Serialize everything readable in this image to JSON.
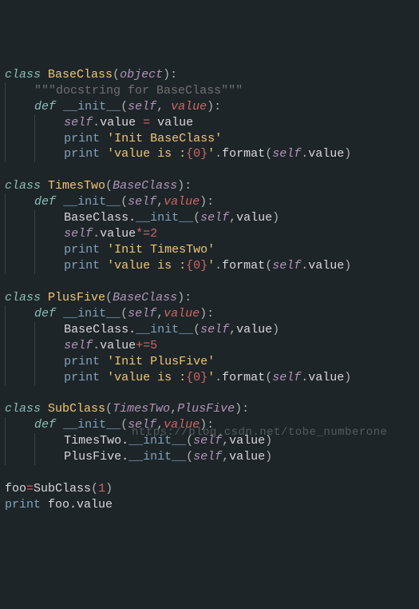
{
  "code": {
    "lines": [
      {
        "indent": 0,
        "tokens": [
          {
            "t": "kw-storage",
            "v": "class"
          },
          {
            "t": "plain",
            "v": " "
          },
          {
            "t": "class-name",
            "v": "BaseClass"
          },
          {
            "t": "punct",
            "v": "("
          },
          {
            "t": "base-class",
            "v": "object"
          },
          {
            "t": "punct",
            "v": "):"
          }
        ]
      },
      {
        "indent": 1,
        "tokens": [
          {
            "t": "comment",
            "v": "\"\"\"docstring for BaseClass\"\"\""
          }
        ]
      },
      {
        "indent": 1,
        "tokens": [
          {
            "t": "kw-def",
            "v": "def"
          },
          {
            "t": "plain",
            "v": " "
          },
          {
            "t": "func-name",
            "v": "__init__"
          },
          {
            "t": "punct",
            "v": "("
          },
          {
            "t": "param-self",
            "v": "self"
          },
          {
            "t": "punct",
            "v": ", "
          },
          {
            "t": "param",
            "v": "value"
          },
          {
            "t": "punct",
            "v": "):"
          }
        ]
      },
      {
        "indent": 2,
        "tokens": [
          {
            "t": "self-ref",
            "v": "self"
          },
          {
            "t": "punct",
            "v": "."
          },
          {
            "t": "plain",
            "v": "value "
          },
          {
            "t": "op",
            "v": "="
          },
          {
            "t": "plain",
            "v": " value"
          }
        ]
      },
      {
        "indent": 2,
        "tokens": [
          {
            "t": "print-kw",
            "v": "print"
          },
          {
            "t": "plain",
            "v": " "
          },
          {
            "t": "string",
            "v": "'Init BaseClass'"
          }
        ]
      },
      {
        "indent": 2,
        "tokens": [
          {
            "t": "print-kw",
            "v": "print"
          },
          {
            "t": "plain",
            "v": " "
          },
          {
            "t": "string",
            "v": "'value is :"
          },
          {
            "t": "format-spec",
            "v": "{0}"
          },
          {
            "t": "string",
            "v": "'"
          },
          {
            "t": "punct",
            "v": "."
          },
          {
            "t": "plain",
            "v": "format"
          },
          {
            "t": "punct",
            "v": "("
          },
          {
            "t": "self-ref",
            "v": "self"
          },
          {
            "t": "punct",
            "v": "."
          },
          {
            "t": "plain",
            "v": "value"
          },
          {
            "t": "punct",
            "v": ")"
          }
        ]
      },
      {
        "indent": 0,
        "tokens": []
      },
      {
        "indent": 0,
        "tokens": [
          {
            "t": "kw-storage",
            "v": "class"
          },
          {
            "t": "plain",
            "v": " "
          },
          {
            "t": "class-name",
            "v": "TimesTwo"
          },
          {
            "t": "punct",
            "v": "("
          },
          {
            "t": "base-class",
            "v": "BaseClass"
          },
          {
            "t": "punct",
            "v": "):"
          }
        ]
      },
      {
        "indent": 1,
        "tokens": [
          {
            "t": "kw-def",
            "v": "def"
          },
          {
            "t": "plain",
            "v": " "
          },
          {
            "t": "func-name",
            "v": "__init__"
          },
          {
            "t": "punct",
            "v": "("
          },
          {
            "t": "param-self",
            "v": "self"
          },
          {
            "t": "punct",
            "v": ","
          },
          {
            "t": "param",
            "v": "value"
          },
          {
            "t": "punct",
            "v": "):"
          }
        ]
      },
      {
        "indent": 2,
        "tokens": [
          {
            "t": "plain",
            "v": "BaseClass."
          },
          {
            "t": "func-name",
            "v": "__init__"
          },
          {
            "t": "punct",
            "v": "("
          },
          {
            "t": "self-ref",
            "v": "self"
          },
          {
            "t": "punct",
            "v": ","
          },
          {
            "t": "plain",
            "v": "value"
          },
          {
            "t": "punct",
            "v": ")"
          }
        ]
      },
      {
        "indent": 2,
        "tokens": [
          {
            "t": "self-ref",
            "v": "self"
          },
          {
            "t": "punct",
            "v": "."
          },
          {
            "t": "plain",
            "v": "value"
          },
          {
            "t": "op",
            "v": "*="
          },
          {
            "t": "num",
            "v": "2"
          }
        ]
      },
      {
        "indent": 2,
        "tokens": [
          {
            "t": "print-kw",
            "v": "print"
          },
          {
            "t": "plain",
            "v": " "
          },
          {
            "t": "string",
            "v": "'Init TimesTwo'"
          }
        ]
      },
      {
        "indent": 2,
        "tokens": [
          {
            "t": "print-kw",
            "v": "print"
          },
          {
            "t": "plain",
            "v": " "
          },
          {
            "t": "string",
            "v": "'value is :"
          },
          {
            "t": "format-spec",
            "v": "{0}"
          },
          {
            "t": "string",
            "v": "'"
          },
          {
            "t": "punct",
            "v": "."
          },
          {
            "t": "plain",
            "v": "format"
          },
          {
            "t": "punct",
            "v": "("
          },
          {
            "t": "self-ref",
            "v": "self"
          },
          {
            "t": "punct",
            "v": "."
          },
          {
            "t": "plain",
            "v": "value"
          },
          {
            "t": "punct",
            "v": ")"
          }
        ]
      },
      {
        "indent": 0,
        "tokens": []
      },
      {
        "indent": 0,
        "tokens": [
          {
            "t": "kw-storage",
            "v": "class"
          },
          {
            "t": "plain",
            "v": " "
          },
          {
            "t": "class-name",
            "v": "PlusFive"
          },
          {
            "t": "punct",
            "v": "("
          },
          {
            "t": "base-class",
            "v": "BaseClass"
          },
          {
            "t": "punct",
            "v": "):"
          }
        ]
      },
      {
        "indent": 1,
        "tokens": [
          {
            "t": "kw-def",
            "v": "def"
          },
          {
            "t": "plain",
            "v": " "
          },
          {
            "t": "func-name",
            "v": "__init__"
          },
          {
            "t": "punct",
            "v": "("
          },
          {
            "t": "param-self",
            "v": "self"
          },
          {
            "t": "punct",
            "v": ","
          },
          {
            "t": "param",
            "v": "value"
          },
          {
            "t": "punct",
            "v": "):"
          }
        ]
      },
      {
        "indent": 2,
        "tokens": [
          {
            "t": "plain",
            "v": "BaseClass."
          },
          {
            "t": "func-name",
            "v": "__init__"
          },
          {
            "t": "punct",
            "v": "("
          },
          {
            "t": "self-ref",
            "v": "self"
          },
          {
            "t": "punct",
            "v": ","
          },
          {
            "t": "plain",
            "v": "value"
          },
          {
            "t": "punct",
            "v": ")"
          }
        ]
      },
      {
        "indent": 2,
        "tokens": [
          {
            "t": "self-ref",
            "v": "self"
          },
          {
            "t": "punct",
            "v": "."
          },
          {
            "t": "plain",
            "v": "value"
          },
          {
            "t": "op",
            "v": "+="
          },
          {
            "t": "num",
            "v": "5"
          }
        ]
      },
      {
        "indent": 2,
        "tokens": [
          {
            "t": "print-kw",
            "v": "print"
          },
          {
            "t": "plain",
            "v": " "
          },
          {
            "t": "string",
            "v": "'Init PlusFive'"
          }
        ]
      },
      {
        "indent": 2,
        "tokens": [
          {
            "t": "print-kw",
            "v": "print"
          },
          {
            "t": "plain",
            "v": " "
          },
          {
            "t": "string",
            "v": "'value is :"
          },
          {
            "t": "format-spec",
            "v": "{0}"
          },
          {
            "t": "string",
            "v": "'"
          },
          {
            "t": "punct",
            "v": "."
          },
          {
            "t": "plain",
            "v": "format"
          },
          {
            "t": "punct",
            "v": "("
          },
          {
            "t": "self-ref",
            "v": "self"
          },
          {
            "t": "punct",
            "v": "."
          },
          {
            "t": "plain",
            "v": "value"
          },
          {
            "t": "punct",
            "v": ")"
          }
        ]
      },
      {
        "indent": 0,
        "tokens": []
      },
      {
        "indent": 0,
        "tokens": [
          {
            "t": "kw-storage",
            "v": "class"
          },
          {
            "t": "plain",
            "v": " "
          },
          {
            "t": "class-name",
            "v": "SubClass"
          },
          {
            "t": "punct",
            "v": "("
          },
          {
            "t": "base-class",
            "v": "TimesTwo"
          },
          {
            "t": "punct",
            "v": ","
          },
          {
            "t": "base-class",
            "v": "PlusFive"
          },
          {
            "t": "punct",
            "v": "):"
          }
        ]
      },
      {
        "indent": 1,
        "tokens": [
          {
            "t": "kw-def",
            "v": "def"
          },
          {
            "t": "plain",
            "v": " "
          },
          {
            "t": "func-name",
            "v": "__init__"
          },
          {
            "t": "punct",
            "v": "("
          },
          {
            "t": "param-self",
            "v": "self"
          },
          {
            "t": "punct",
            "v": ","
          },
          {
            "t": "param",
            "v": "value"
          },
          {
            "t": "punct",
            "v": "):"
          }
        ]
      },
      {
        "indent": 2,
        "tokens": [
          {
            "t": "plain",
            "v": "TimesTwo."
          },
          {
            "t": "func-name",
            "v": "__init__"
          },
          {
            "t": "punct",
            "v": "("
          },
          {
            "t": "self-ref",
            "v": "self"
          },
          {
            "t": "punct",
            "v": ","
          },
          {
            "t": "plain",
            "v": "value"
          },
          {
            "t": "punct",
            "v": ")"
          }
        ]
      },
      {
        "indent": 2,
        "tokens": [
          {
            "t": "plain",
            "v": "PlusFive."
          },
          {
            "t": "func-name",
            "v": "__init__"
          },
          {
            "t": "punct",
            "v": "("
          },
          {
            "t": "self-ref",
            "v": "self"
          },
          {
            "t": "punct",
            "v": ","
          },
          {
            "t": "plain",
            "v": "value"
          },
          {
            "t": "punct",
            "v": ")"
          }
        ]
      },
      {
        "indent": 0,
        "tokens": []
      },
      {
        "indent": 0,
        "tokens": [
          {
            "t": "plain",
            "v": "foo"
          },
          {
            "t": "op",
            "v": "="
          },
          {
            "t": "plain",
            "v": "SubClass"
          },
          {
            "t": "punct",
            "v": "("
          },
          {
            "t": "num",
            "v": "1"
          },
          {
            "t": "punct",
            "v": ")"
          }
        ]
      },
      {
        "indent": 0,
        "tokens": [
          {
            "t": "print-kw",
            "v": "print"
          },
          {
            "t": "plain",
            "v": " foo.value"
          }
        ]
      }
    ]
  },
  "watermark": "https://blog.csdn.net/tobe_numberone"
}
